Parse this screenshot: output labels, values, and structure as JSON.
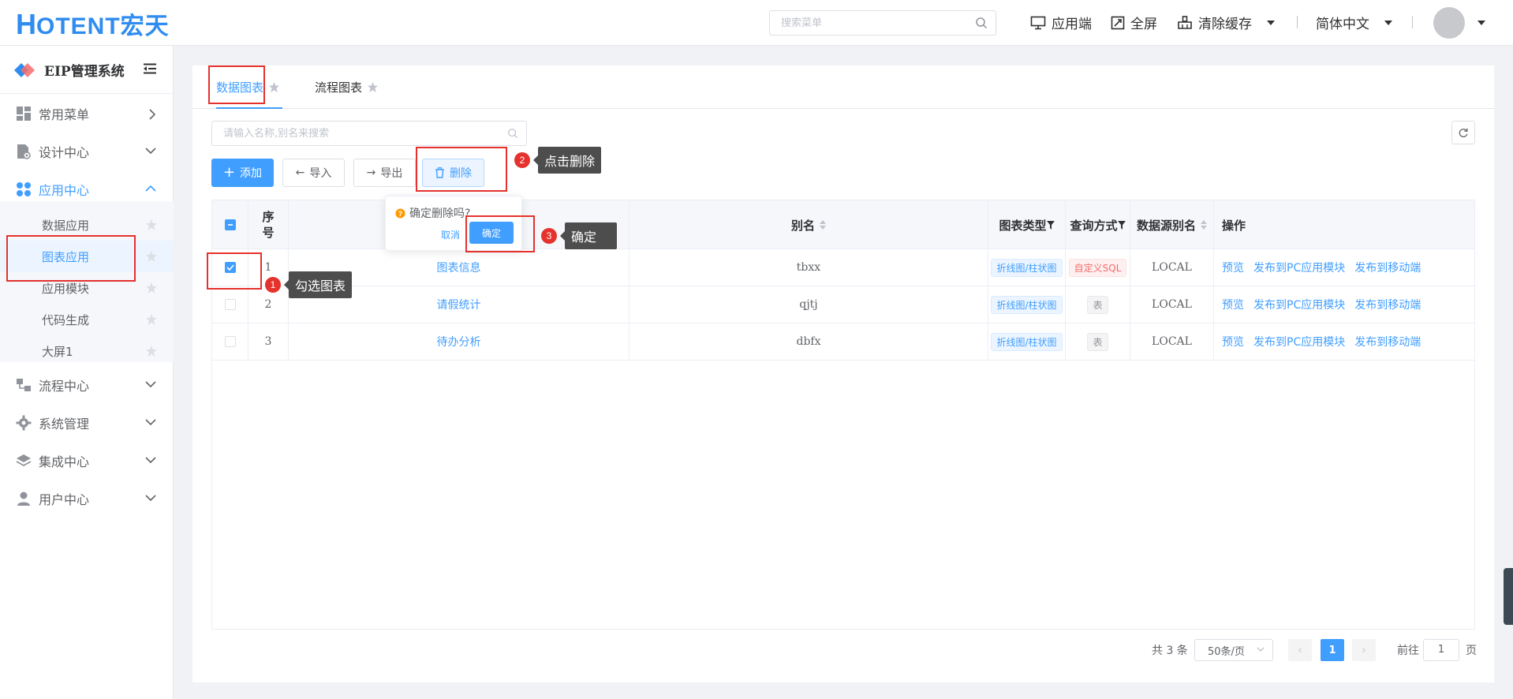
{
  "header": {
    "logo_h": "H",
    "logo_rest": "OTENT宏天",
    "search_placeholder": "搜索菜单",
    "app_end": "应用端",
    "fullscreen": "全屏",
    "clear_cache": "清除缓存",
    "language": "简体中文"
  },
  "sidebar": {
    "title": "EIP管理系统",
    "menus": [
      {
        "label": "常用菜单"
      },
      {
        "label": "设计中心"
      },
      {
        "label": "应用中心"
      },
      {
        "label": "流程中心"
      },
      {
        "label": "系统管理"
      },
      {
        "label": "集成中心"
      },
      {
        "label": "用户中心"
      }
    ],
    "sub_items": [
      {
        "label": "数据应用"
      },
      {
        "label": "图表应用"
      },
      {
        "label": "应用模块"
      },
      {
        "label": "代码生成"
      },
      {
        "label": "大屏1"
      }
    ]
  },
  "main": {
    "tabs": [
      {
        "label": "数据图表"
      },
      {
        "label": "流程图表"
      }
    ],
    "search_placeholder": "请输入名称,别名来搜索",
    "buttons": {
      "add": "添加",
      "import": "导入",
      "export": "导出",
      "delete": "删除"
    },
    "columns": {
      "seq": "序号",
      "alias": "别名",
      "chart_type": "图表类型",
      "query_mode": "查询方式",
      "datasource": "数据源别名",
      "ops": "操作"
    },
    "rows": [
      {
        "seq": "1",
        "name": "图表信息",
        "alias": "tbxx",
        "chart_type": "折线图/柱状图",
        "query": "自定义SQL",
        "ds": "LOCAL",
        "op1": "预览",
        "op2": "发布到PC应用模块",
        "op3": "发布到移动端"
      },
      {
        "seq": "2",
        "name": "请假统计",
        "alias": "qjtj",
        "chart_type": "折线图/柱状图",
        "query": "表",
        "ds": "LOCAL",
        "op1": "预览",
        "op2": "发布到PC应用模块",
        "op3": "发布到移动端"
      },
      {
        "seq": "3",
        "name": "待办分析",
        "alias": "dbfx",
        "chart_type": "折线图/柱状图",
        "query": "表",
        "ds": "LOCAL",
        "op1": "预览",
        "op2": "发布到PC应用模块",
        "op3": "发布到移动端"
      }
    ],
    "pagination": {
      "total": "共 3 条",
      "page_size": "50条/页",
      "current": "1",
      "goto_label": "前往",
      "goto_value": "1",
      "page_unit": "页"
    },
    "popconfirm": {
      "message": "确定删除吗?",
      "cancel": "取消",
      "ok": "确定"
    }
  },
  "annotations": [
    {
      "num": "1",
      "text": "勾选图表"
    },
    {
      "num": "2",
      "text": "点击删除"
    },
    {
      "num": "3",
      "text": "确定"
    }
  ],
  "colors": {
    "accent": "#409eff",
    "annotation_red": "#e5322d",
    "tip_bg": "#4d4d4d"
  }
}
